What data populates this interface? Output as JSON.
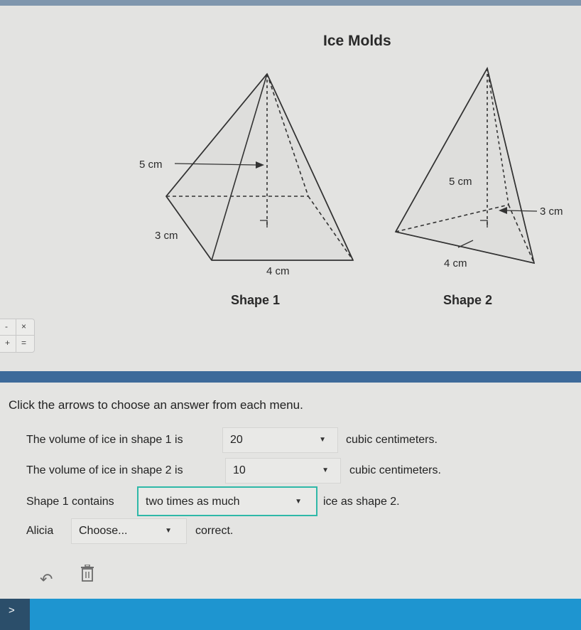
{
  "figure": {
    "title": "Ice Molds",
    "shape1": {
      "label": "Shape 1",
      "slant_height": "5 cm",
      "width": "3 cm",
      "length": "4 cm"
    },
    "shape2": {
      "label": "Shape 2",
      "height": "5 cm",
      "width": "3 cm",
      "length": "4 cm"
    }
  },
  "zoom": {
    "minus": "-",
    "close": "×",
    "plus": "+",
    "equals": "="
  },
  "question": {
    "instruction": "Click the arrows to choose an answer from each menu.",
    "rows": [
      {
        "prefix": "The volume of ice in shape 1 is",
        "selected": "20",
        "suffix": "cubic centimeters."
      },
      {
        "prefix": "The volume of ice in shape 2 is",
        "selected": "10",
        "suffix": "cubic centimeters."
      },
      {
        "prefix": "Shape 1 contains",
        "selected": "two times as much",
        "suffix": "ice as shape 2."
      },
      {
        "prefix": "Alicia",
        "selected": "Choose...",
        "suffix": "correct."
      }
    ]
  },
  "colors": {
    "accent": "#2fb8a8",
    "band": "#3d6a9a",
    "bottom": "#1e95d0"
  },
  "icons": {
    "undo": "undo-icon",
    "trash": "trash-icon",
    "next": "chevron-right-icon"
  },
  "nav": {
    "next": ">"
  }
}
